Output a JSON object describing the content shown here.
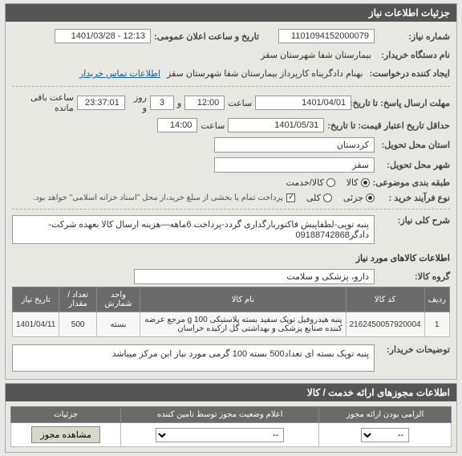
{
  "header": {
    "title": "جزئیات اطلاعات نیاز"
  },
  "form": {
    "need_no_label": "شماره نیاز:",
    "need_no": "1101094152000079",
    "public_announce_label": "تاریخ و ساعت اعلان عمومی:",
    "public_announce": "12:13 - 1401/03/28",
    "buyer_label": "نام دستگاه خریدار:",
    "buyer": "بیمارستان شفا شهرستان سقز",
    "creator_label": "ایجاد کننده درخواست:",
    "creator": "بهنام دادگریناه کارپرداز بیمارستان شفا شهرستان سقز",
    "contact_link": "اطلاعات تماس خریدار",
    "deadline_label": "مهلت ارسال پاسخ: تا تاریخ:",
    "deadline_date": "1401/04/01",
    "time_label": "ساعت",
    "deadline_time": "12:00",
    "and": "و",
    "deadline_days": "3",
    "day_label": "روز و",
    "deadline_remain": "23:37:01",
    "remain_label": "ساعت باقی مانده",
    "min_valid_label": "حداقل تاریخ اعتبار قیمت: تا تاریخ:",
    "min_valid_date": "1401/05/31",
    "min_valid_time": "14:00",
    "province_label": "استان محل تحویل:",
    "province": "کردستان",
    "city_label": "شهر محل تحویل:",
    "city": "سقز",
    "category_label": "طبقه بندی موضوعی:",
    "cat_options": {
      "kala": "کالا",
      "khadmat": "کالا/خدمت"
    },
    "process_label": "نوع فرآیند خرید :",
    "process_options": {
      "partial": "جزئی",
      "total": "کلی"
    },
    "process_note": "پرداخت تمام یا بخشی از مبلغ خرید،از محل \"اسناد خزانه اسلامی\" خواهد بود.",
    "desc_label": "شرح کلی نیاز:",
    "desc": "پنبه توپی-لطفاپیش فاکتوربارگذاری گردد-پرداخت 6ماهه—هزینه ارسال کالا بعهده شرکت-دادگر09188742868",
    "items_title": "اطلاعات کالاهای مورد نیاز",
    "group_label": "گروه کالا:",
    "group": "دارو، پزشکی و سلامت",
    "table": {
      "headers": [
        "ردیف",
        "کد کالا",
        "نام کالا",
        "واحد شمارش",
        "تعداد / مقدار",
        "تاریخ نیاز"
      ],
      "rows": [
        {
          "idx": "1",
          "code": "2162450057920004",
          "name": "پنبه هیدروفیل توپک سفید بسته پلاستیکی 100 g مرجع عرضه کننده صنایع پزشکی و بهداشتی گل ارکیده خراسان",
          "unit": "بسته",
          "qty": "500",
          "date": "1401/04/11"
        }
      ]
    },
    "buyer_notes_label": "توضیحات خریدار:",
    "buyer_notes": "پنبه توپک بسته ای تعداد500 بسته 100 گرمی مورد نیاز این مرکز میباشد"
  },
  "permits": {
    "title": "اطلاعات مجوزهای ارائه خدمت / کالا",
    "headers": [
      "الزامی بودن ارائه مجوز",
      "اعلام وضعیت مجوز توسط تامین کننده",
      "جزئیات"
    ],
    "select_placeholder": "--",
    "view_btn": "مشاهده مجوز"
  }
}
